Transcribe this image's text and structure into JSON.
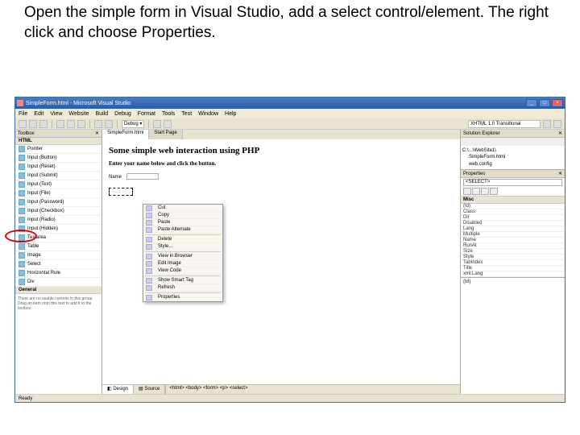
{
  "instruction": "Open the simple form in Visual Studio, add a select control/element. The right click and choose Properties.",
  "titlebar": {
    "title": "SimpleForm.html - Microsoft Visual Studio"
  },
  "menubar": [
    "File",
    "Edit",
    "View",
    "Website",
    "Build",
    "Debug",
    "Format",
    "Tools",
    "Test",
    "Window",
    "Help"
  ],
  "toolbar_dropdown": "XHTML 1.0 Transitional",
  "toolbox": {
    "title": "Toolbox",
    "groups": {
      "html": "HTML",
      "general": "General"
    },
    "items": [
      "Pointer",
      "Input (Button)",
      "Input (Reset)",
      "Input (Submit)",
      "Input (Text)",
      "Input (File)",
      "Input (Password)",
      "Input (Checkbox)",
      "Input (Radio)",
      "Input (Hidden)",
      "Textarea",
      "Table",
      "Image",
      "Select",
      "Horizontal Rule",
      "Div"
    ],
    "msg": "There are no usable controls in this group. Drag an item onto this text to add it to the toolbox."
  },
  "editor": {
    "tabs": [
      "SimpleForm.html",
      "Start Page"
    ],
    "heading": "Some simple web interaction using PHP",
    "sub": "Enter your name below and click the button.",
    "name_label": "Name",
    "bottom_tabs": [
      "Design",
      "Source"
    ]
  },
  "context_menu": [
    "Cut",
    "Copy",
    "Paste",
    "Paste Alternate",
    "Delete",
    "Style...",
    "View in Browser",
    "Edit Image",
    "View Code",
    "Show Smart Tag",
    "Refresh",
    "Properties"
  ],
  "solution": {
    "title": "Solution Explorer",
    "root": "C:\\...\\WebSite1\\",
    "items": [
      "SimpleForm.html",
      "web.config"
    ]
  },
  "properties": {
    "title": "Properties",
    "selector": "<SELECT>",
    "category": "Misc",
    "rows": [
      {
        "k": "(Id)",
        "v": ""
      },
      {
        "k": "Class",
        "v": ""
      },
      {
        "k": "Dir",
        "v": ""
      },
      {
        "k": "Disabled",
        "v": ""
      },
      {
        "k": "Lang",
        "v": ""
      },
      {
        "k": "Multiple",
        "v": ""
      },
      {
        "k": "Name",
        "v": ""
      },
      {
        "k": "RunAt",
        "v": ""
      },
      {
        "k": "Size",
        "v": ""
      },
      {
        "k": "Style",
        "v": ""
      },
      {
        "k": "TabIndex",
        "v": ""
      },
      {
        "k": "Title",
        "v": ""
      },
      {
        "k": "xml:Lang",
        "v": ""
      }
    ],
    "desc_title": "(Id)"
  },
  "statusbar": "Ready"
}
